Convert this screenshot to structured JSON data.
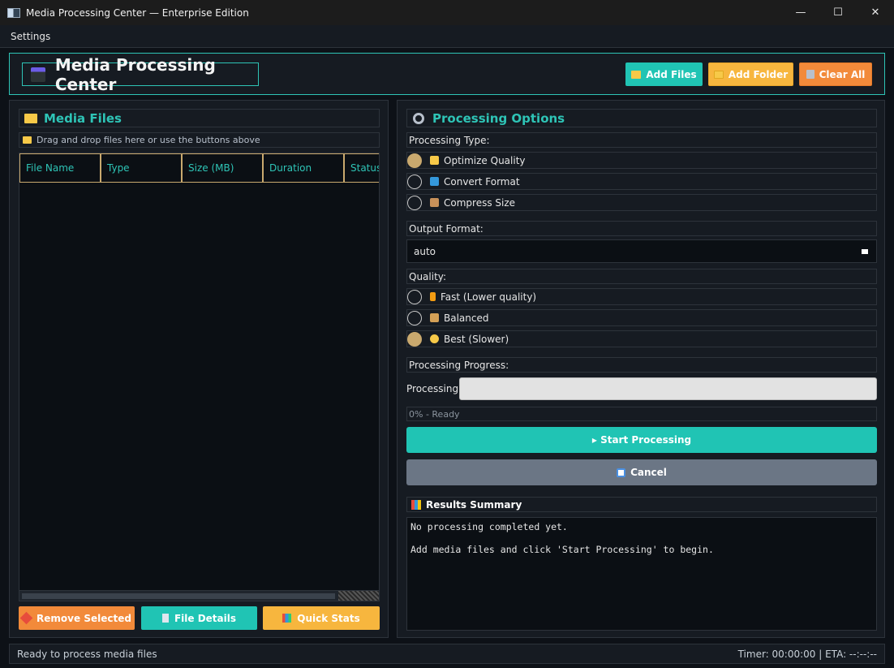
{
  "window": {
    "title": "Media Processing Center — Enterprise Edition",
    "minimize": "—",
    "maximize": "☐",
    "close": "✕"
  },
  "menu": {
    "items": [
      "Settings"
    ]
  },
  "header": {
    "app_title": "Media Processing Center",
    "add_files": "Add Files",
    "add_folder": "Add Folder",
    "clear_all": "Clear All"
  },
  "media_files": {
    "title": "Media Files",
    "hint": "Drag and drop files here or use the buttons above",
    "columns": [
      "File Name",
      "Type",
      "Size (MB)",
      "Duration",
      "Status"
    ],
    "rows": [],
    "remove_selected": "Remove Selected",
    "file_details": "File Details",
    "quick_stats": "Quick Stats"
  },
  "options": {
    "title": "Processing Options",
    "processing_type_label": "Processing Type:",
    "processing_types": [
      {
        "label": "Optimize Quality",
        "selected": true,
        "icon": "sparkles-icon"
      },
      {
        "label": "Convert Format",
        "selected": false,
        "icon": "convert-icon"
      },
      {
        "label": "Compress Size",
        "selected": false,
        "icon": "package-icon"
      }
    ],
    "output_format_label": "Output Format:",
    "output_format_value": "auto",
    "quality_label": "Quality:",
    "qualities": [
      {
        "label": "Fast (Lower quality)",
        "selected": false,
        "icon": "lightning-icon"
      },
      {
        "label": "Balanced",
        "selected": false,
        "icon": "scales-icon"
      },
      {
        "label": "Best (Slower)",
        "selected": true,
        "icon": "star-icon"
      }
    ],
    "progress_section_label": "Processing Progress:",
    "progress_label": "Processing:",
    "progress_value": 0,
    "progress_status": "0% - Ready",
    "start_button": "▸ Start Processing",
    "cancel_button": "Cancel"
  },
  "results": {
    "title": "Results Summary",
    "text": "No processing completed yet.\n\nAdd media files and click 'Start Processing' to begin."
  },
  "status": {
    "left": "Ready to process media files",
    "right": "Timer: 00:00:00 | ETA: --:--:--"
  },
  "colors": {
    "accent": "#2ec4b6",
    "button_teal": "#20c4b4",
    "button_yellow": "#f7b63e",
    "button_orange": "#f28a3a",
    "radio_selected": "#c9a96e",
    "background": "#0d1117"
  }
}
